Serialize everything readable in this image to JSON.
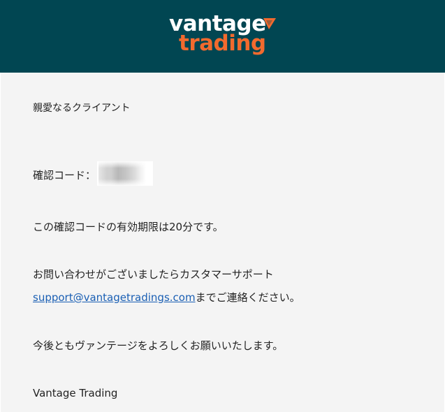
{
  "header": {
    "logo_word_top": "vantage",
    "logo_word_bottom": "trading",
    "background_color": "#014652",
    "accent_color": "#f26a2e"
  },
  "email": {
    "greeting": "親愛なるクライアント",
    "code_label": "確認コード：",
    "code_value_blurred": true,
    "validity_text": "この確認コードの有効期限は20分です。",
    "inquiry_line1": "お問い合わせがございましたらカスタマーサポート",
    "support_email": "support@vantagetradings.com",
    "inquiry_line2_suffix": "までご連絡ください。",
    "closing": "今後ともヴァンテージをよろしくお願いいたします。",
    "signature": "Vantage Trading"
  }
}
